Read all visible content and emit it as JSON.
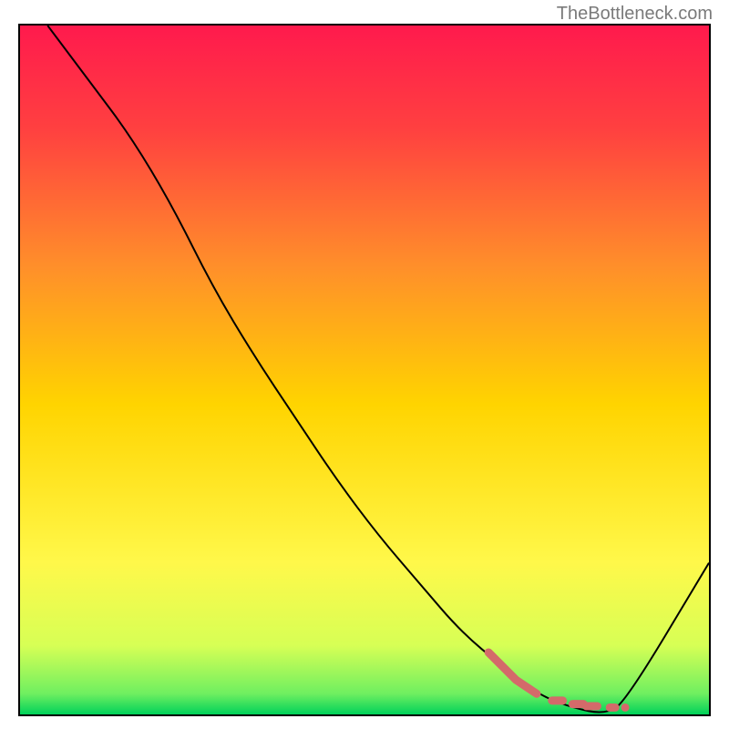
{
  "watermark": "TheBottleneck.com",
  "chart_data": {
    "type": "line",
    "title": "",
    "xlabel": "",
    "ylabel": "",
    "xlim": [
      0,
      100
    ],
    "ylim": [
      0,
      100
    ],
    "gradient": {
      "top_color": "#ff1a4d",
      "mid_color": "#ffd400",
      "bottom_color": "#00d15a"
    },
    "series": [
      {
        "name": "main-curve",
        "stroke": "#000000",
        "x": [
          4,
          10,
          16,
          22,
          28,
          34,
          40,
          46,
          52,
          58,
          64,
          70,
          75,
          80,
          85,
          88,
          100
        ],
        "y": [
          100,
          92,
          84,
          74,
          62,
          52,
          43,
          34,
          26,
          19,
          12,
          7,
          3,
          1,
          0,
          2,
          22
        ]
      },
      {
        "name": "highlight-segment",
        "stroke": "#d46a6a",
        "style": "thick-dashed",
        "x": [
          68,
          72,
          75,
          78,
          81,
          83,
          86
        ],
        "y": [
          9,
          5,
          3,
          2,
          1.5,
          1.2,
          1
        ]
      }
    ]
  }
}
